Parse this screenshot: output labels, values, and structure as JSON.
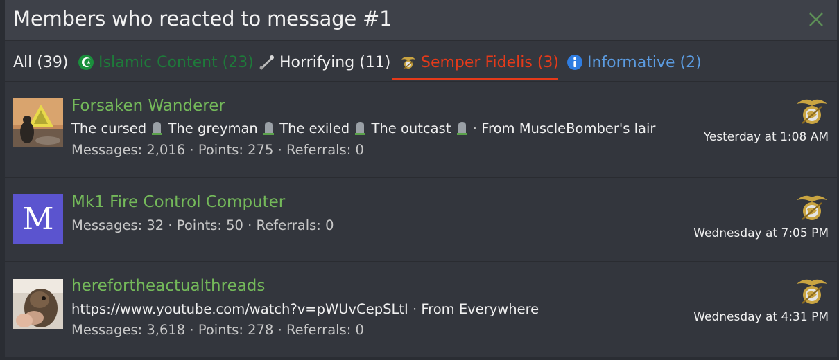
{
  "dialog": {
    "title": "Members who reacted to message #1"
  },
  "tabs": [
    {
      "label": "All (39)",
      "color": "#f0f0f0"
    },
    {
      "label": "Islamic Content (23)",
      "color": "#1e7a3a"
    },
    {
      "label": "Horrifying (11)",
      "color": "#f0f0f0"
    },
    {
      "label": "Semper Fidelis (3)",
      "color": "#e53a1a",
      "selected": true
    },
    {
      "label": "Informative (2)",
      "color": "#5b9be0"
    }
  ],
  "members": [
    {
      "name": "Forsaken Wanderer",
      "titles": [
        "The cursed",
        "The greyman",
        "The exiled",
        "The outcast"
      ],
      "from": "From MuscleBomber's lair",
      "stats": "Messages: 2,016 · Points: 275 · Referrals: 0",
      "time": "Yesterday at 1:08 AM"
    },
    {
      "name": "Mk1 Fire Control Computer",
      "avatar_letter": "M",
      "avatar_color": "#5b54cf",
      "stats": "Messages: 32 · Points: 50 · Referrals: 0",
      "time": "Wednesday at 7:05 PM"
    },
    {
      "name": "herefortheactualthreads",
      "link": "https://www.youtube.com/watch?v=pWUvCepSLtI",
      "from": "From Everywhere",
      "stats": "Messages: 3,618 · Points: 278 · Referrals: 0",
      "time": "Wednesday at 4:31 PM"
    }
  ]
}
